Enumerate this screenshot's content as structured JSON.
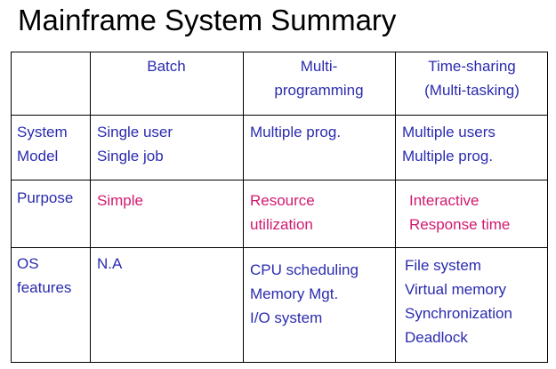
{
  "title": "Mainframe System Summary",
  "colors": {
    "text_blue": "#2b2bb0",
    "text_pink": "#d11a6e",
    "border": "#000000"
  },
  "table": {
    "headers": {
      "col1": [],
      "col2": [
        "Batch"
      ],
      "col3": [
        "Multi-",
        "programming"
      ],
      "col4": [
        "Time-sharing",
        "(Multi-tasking)"
      ]
    },
    "rows": [
      {
        "label": [
          "System",
          "Model"
        ],
        "batch": [
          "Single user",
          "Single job"
        ],
        "multiprogramming": [
          "Multiple prog."
        ],
        "timesharing": [
          "Multiple users",
          "Multiple prog."
        ]
      },
      {
        "label": [
          "Purpose"
        ],
        "batch": [
          "Simple"
        ],
        "multiprogramming": [
          "Resource",
          "utilization"
        ],
        "timesharing": [
          "Interactive",
          "Response time"
        ]
      },
      {
        "label": [
          "OS",
          "features"
        ],
        "batch": [
          "N.A"
        ],
        "multiprogramming": [
          "CPU scheduling",
          "Memory Mgt.",
          "I/O system"
        ],
        "timesharing": [
          "File system",
          "Virtual memory",
          "Synchronization",
          "Deadlock"
        ]
      }
    ]
  }
}
